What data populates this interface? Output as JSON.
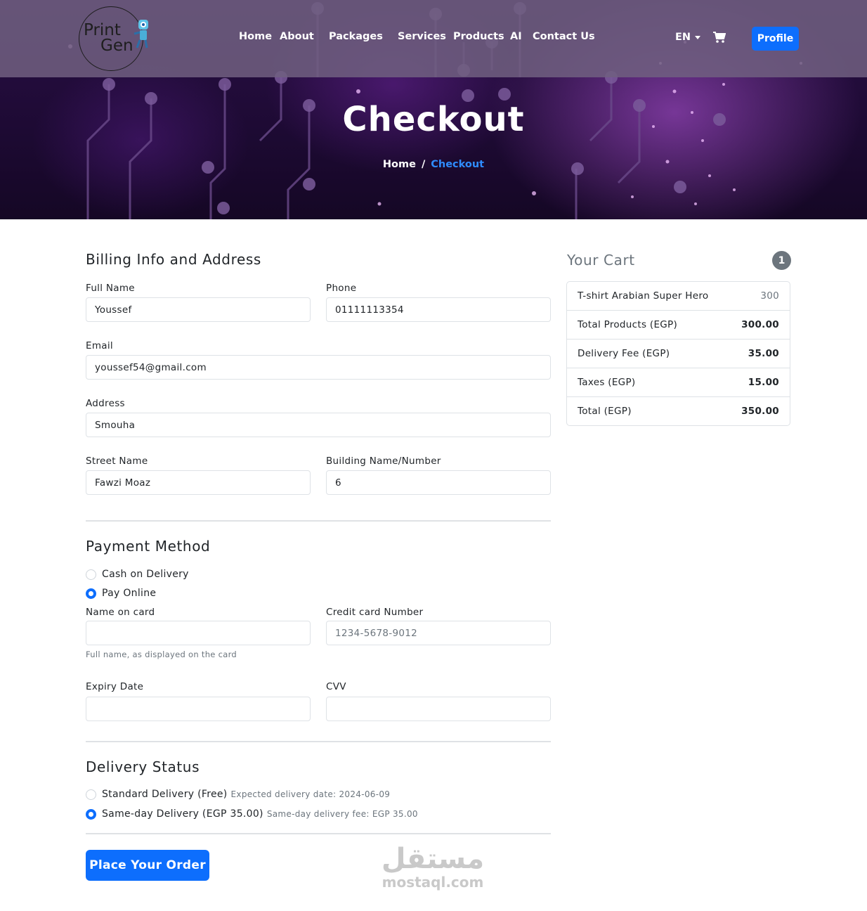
{
  "brand": {
    "logo_line1": "Print",
    "logo_line2": "Gen"
  },
  "nav": {
    "links": [
      "Home",
      "About",
      "Packages",
      "Services",
      "Products",
      "AI",
      "Contact Us"
    ],
    "language": "EN",
    "profile_label": "Profile"
  },
  "hero": {
    "title": "Checkout",
    "breadcrumb": {
      "home": "Home",
      "separator": "/",
      "current": "Checkout"
    }
  },
  "billing": {
    "title": "Billing Info and Address",
    "full_name": {
      "label": "Full Name",
      "value": "Youssef"
    },
    "phone": {
      "label": "Phone",
      "value": "01111113354"
    },
    "email": {
      "label": "Email",
      "value": "youssef54@gmail.com"
    },
    "address": {
      "label": "Address",
      "value": "Smouha"
    },
    "street": {
      "label": "Street Name",
      "value": "Fawzi Moaz"
    },
    "building": {
      "label": "Building Name/Number",
      "value": "6"
    }
  },
  "payment": {
    "title": "Payment Method",
    "options": [
      {
        "label": "Cash on Delivery",
        "checked": false
      },
      {
        "label": "Pay Online",
        "checked": true
      }
    ],
    "name_on_card": {
      "label": "Name on card",
      "value": "",
      "hint": "Full name, as displayed on the card"
    },
    "card_number": {
      "label": "Credit card Number",
      "placeholder": "1234-5678-9012"
    },
    "expiry": {
      "label": "Expiry Date",
      "value": ""
    },
    "cvv": {
      "label": "CVV",
      "value": ""
    }
  },
  "delivery": {
    "title": "Delivery Status",
    "options": [
      {
        "label": "Standard Delivery (Free)",
        "note": "Expected delivery date: 2024-06-09",
        "checked": false
      },
      {
        "label": "Same-day Delivery (EGP 35.00)",
        "note": "Same-day delivery fee: EGP 35.00",
        "checked": true
      }
    ]
  },
  "order_button": "Place Your Order",
  "cart": {
    "title": "Your Cart",
    "count": "1",
    "item": {
      "name": "T-shirt Arabian Super Hero",
      "price": "300"
    },
    "rows": [
      {
        "label": "Total Products (EGP)",
        "value": "300.00"
      },
      {
        "label": "Delivery Fee (EGP)",
        "value": "35.00"
      },
      {
        "label": "Taxes (EGP)",
        "value": "15.00"
      },
      {
        "label": "Total (EGP)",
        "value": "350.00"
      }
    ]
  },
  "watermark": {
    "arabic": "مستقل",
    "latin": "mostaql.com"
  },
  "colors": {
    "primary": "#0d6efd",
    "hero_bg": "#1d0a33",
    "navbar_bg": "#706080",
    "breadcrumb_active": "#2f8cff"
  }
}
